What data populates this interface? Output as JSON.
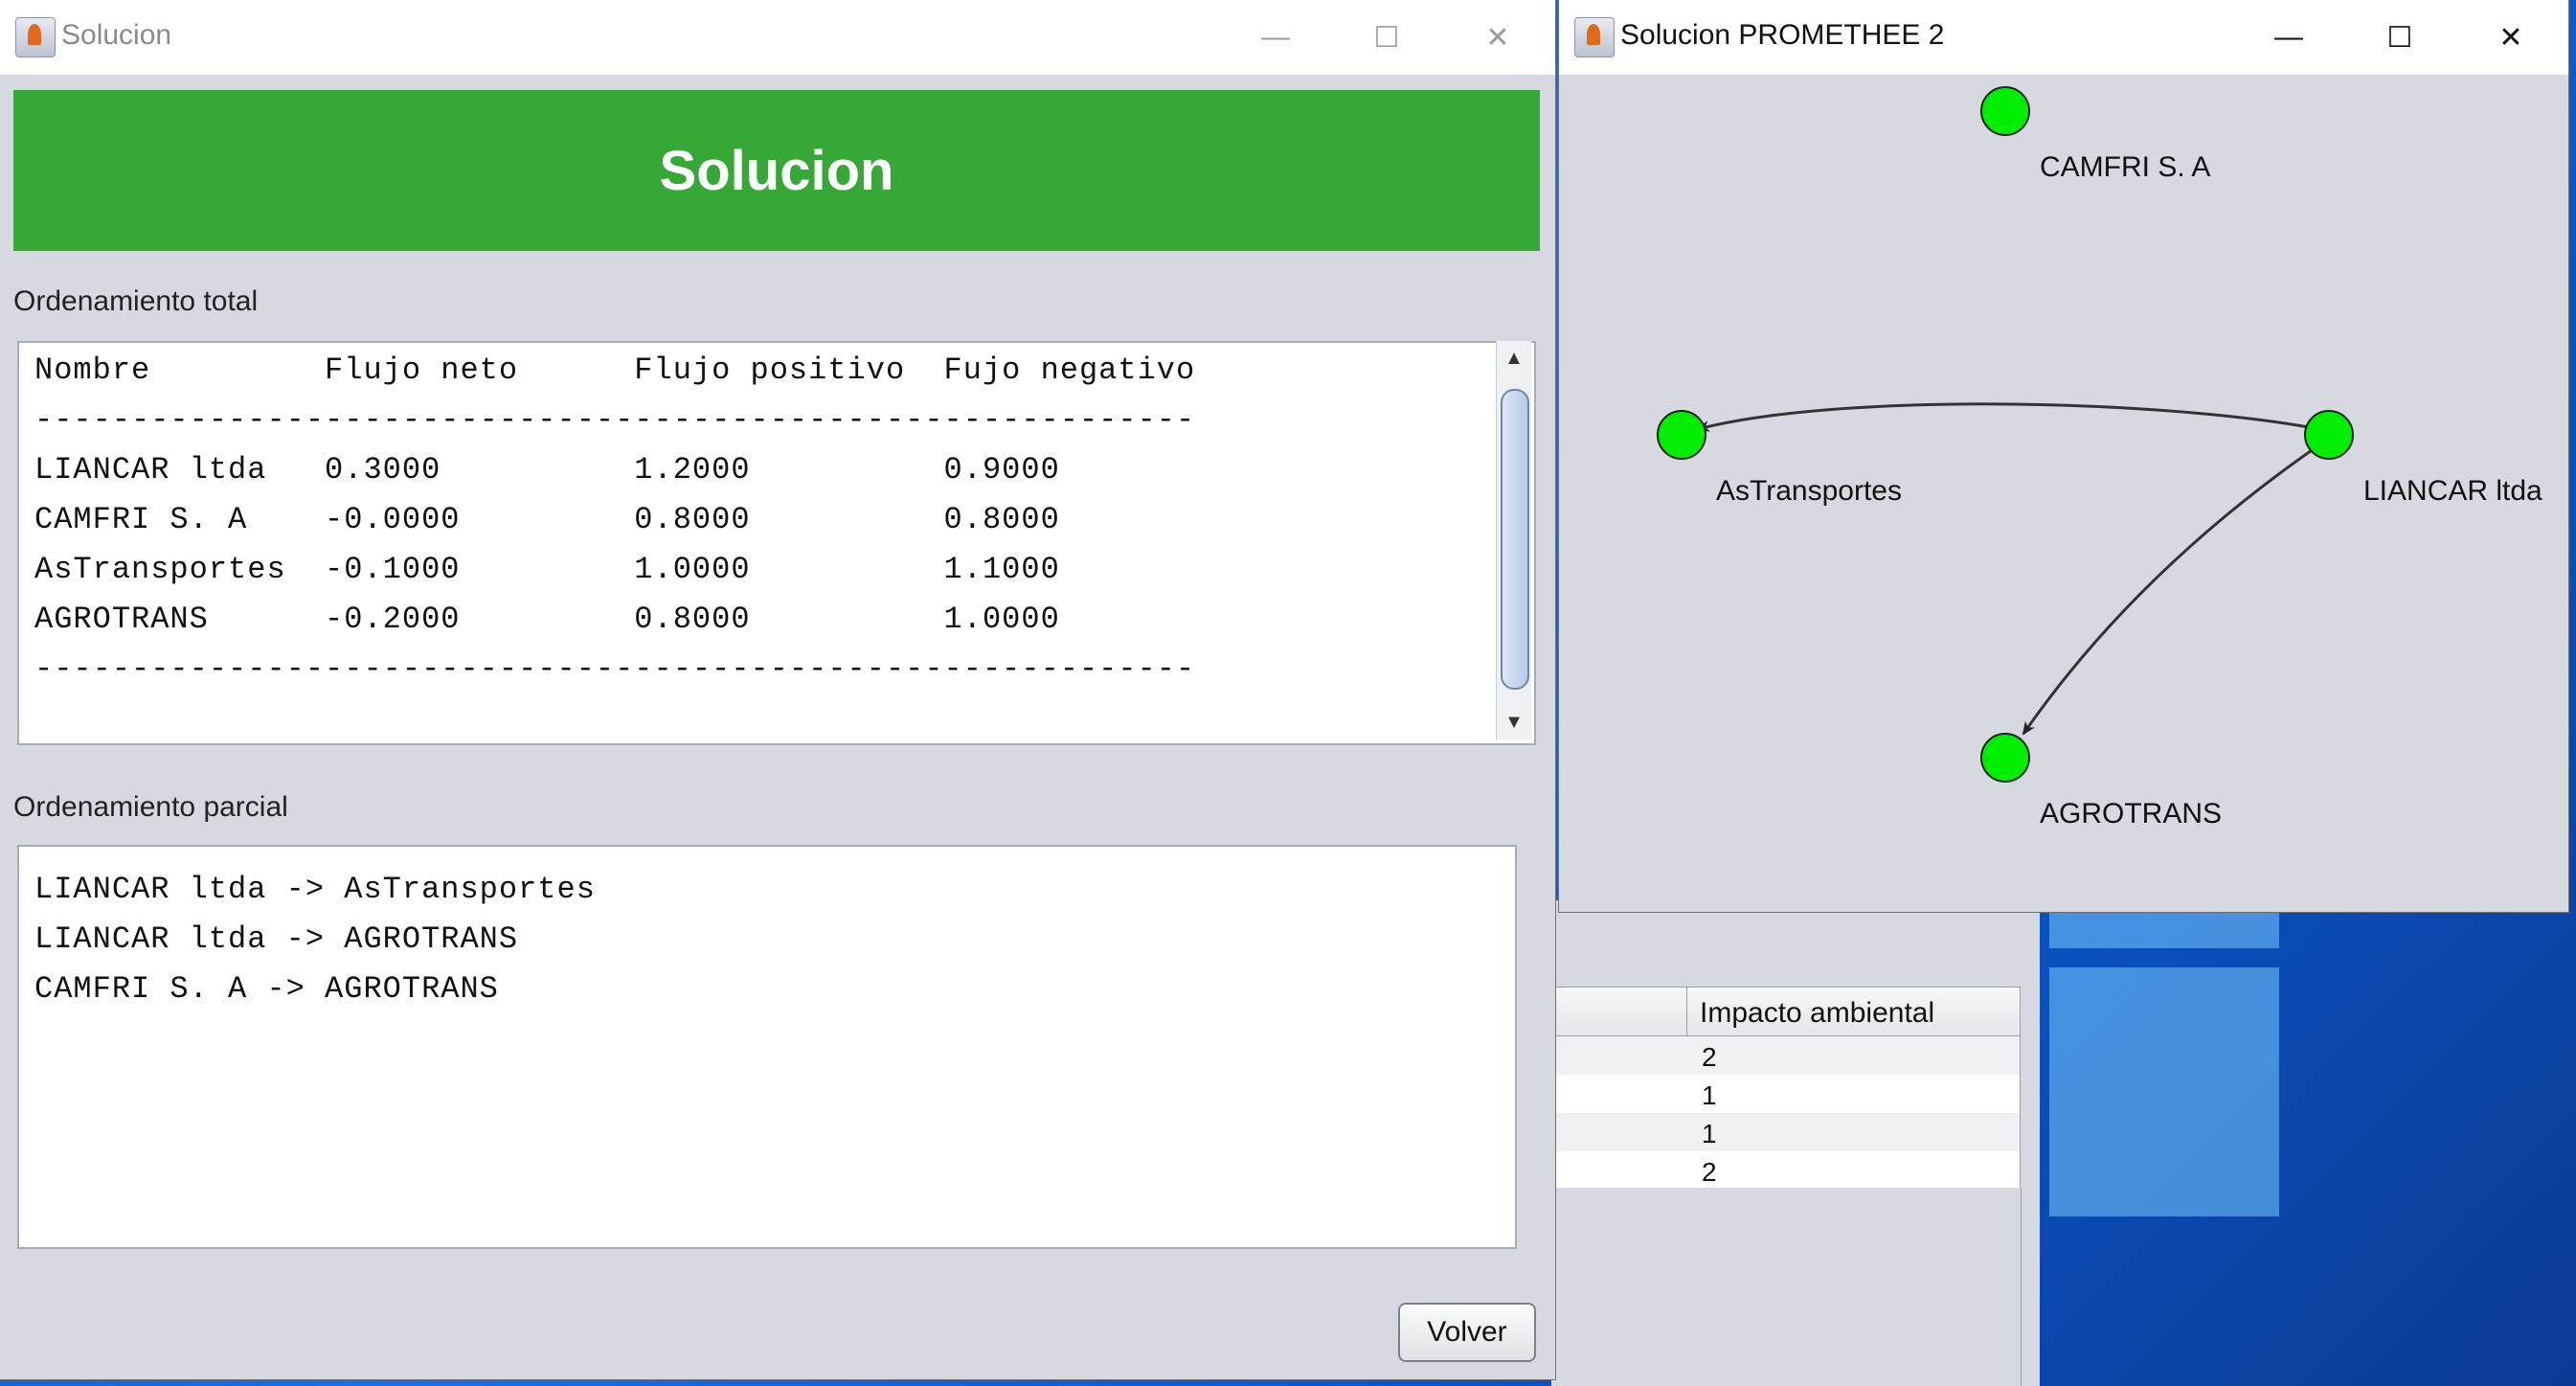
{
  "solution_window": {
    "title": "Solucion",
    "banner": "Solucion",
    "total_label": "Ordenamiento total",
    "total_table": {
      "header": "Nombre         Flujo neto      Flujo positivo  Fujo negativo",
      "divider": "------------------------------------------------------------",
      "rows": [
        "LIANCAR ltda   0.3000          1.2000          0.9000",
        "CAMFRI S. A    -0.0000         0.8000          0.8000",
        "AsTransportes  -0.1000         1.0000          1.1000",
        "AGROTRANS      -0.2000         0.8000          1.0000"
      ]
    },
    "partial_label": "Ordenamiento parcial",
    "partial_lines": [
      "LIANCAR ltda -> AsTransportes",
      "LIANCAR ltda -> AGROTRANS",
      "CAMFRI S. A -> AGROTRANS"
    ],
    "back_button": "Volver"
  },
  "promethee_window": {
    "title": "Solucion PROMETHEE 2",
    "nodes": {
      "camfri": "CAMFRI S. A",
      "astransportes": "AsTransportes",
      "liancar": "LIANCAR ltda",
      "agrotrans": "AGROTRANS"
    },
    "node_color": "#00ee00",
    "edges": [
      {
        "from": "LIANCAR ltda",
        "to": "AsTransportes"
      },
      {
        "from": "LIANCAR ltda",
        "to": "AGROTRANS"
      }
    ]
  },
  "background_table": {
    "column_header": "Impacto ambiental",
    "values": [
      "2",
      "1",
      "1",
      "2"
    ]
  },
  "window_controls": {
    "minimize": "—",
    "maximize": "☐",
    "close": "✕"
  },
  "colors": {
    "banner_green": "#35a835",
    "window_bg": "#d6d9e0"
  }
}
